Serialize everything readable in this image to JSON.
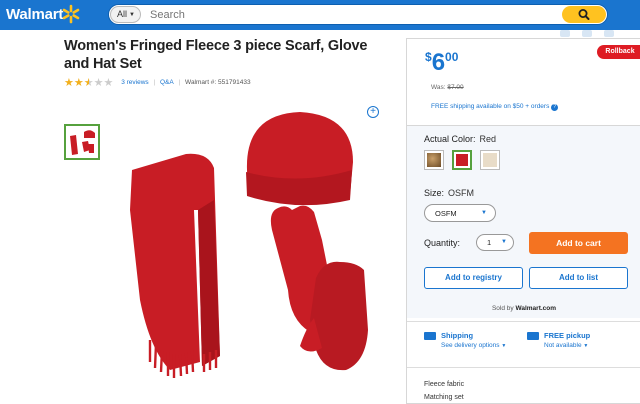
{
  "header": {
    "logo": "Walmart",
    "dept_label": "All",
    "search_placeholder": "Search"
  },
  "product": {
    "title": "Women's Fringed Fleece 3 piece Scarf, Glove and Hat Set",
    "rating": 2.5,
    "rating_max": 5,
    "reviews": "3 reviews",
    "qa": "Q&A",
    "walmart_num": "Walmart #: 551791433"
  },
  "buybox": {
    "price_currency": "$",
    "price_int": "6",
    "price_dec": "00",
    "rollback": "Rollback",
    "was": "Was:",
    "was_price": "$7.00",
    "shipping_note": "FREE shipping available on $50 + orders",
    "color_label": "Actual Color:",
    "color_value": "Red",
    "size_label": "Size:",
    "size_value": "OSFM",
    "size_select": "OSFM",
    "qty_label": "Quantity:",
    "qty_value": "1",
    "add_to_cart": "Add to cart",
    "add_to_registry": "Add to registry",
    "add_to_list": "Add to list",
    "sold_by": "Sold by",
    "seller": "Walmart.com",
    "shipping_title": "Shipping",
    "shipping_sub": "See delivery options",
    "pickup_title": "FREE pickup",
    "pickup_sub": "Not available",
    "features": [
      "Fleece fabric",
      "Matching set"
    ]
  },
  "colors": {
    "brand_blue": "#1a75cf",
    "spark_yellow": "#ffc220",
    "cart_orange": "#f47321",
    "rollback_red": "#de1c24",
    "product_red": "#c81d25",
    "swatch_brown": "#8b6a3e",
    "swatch_cream": "#e8dcc8"
  }
}
